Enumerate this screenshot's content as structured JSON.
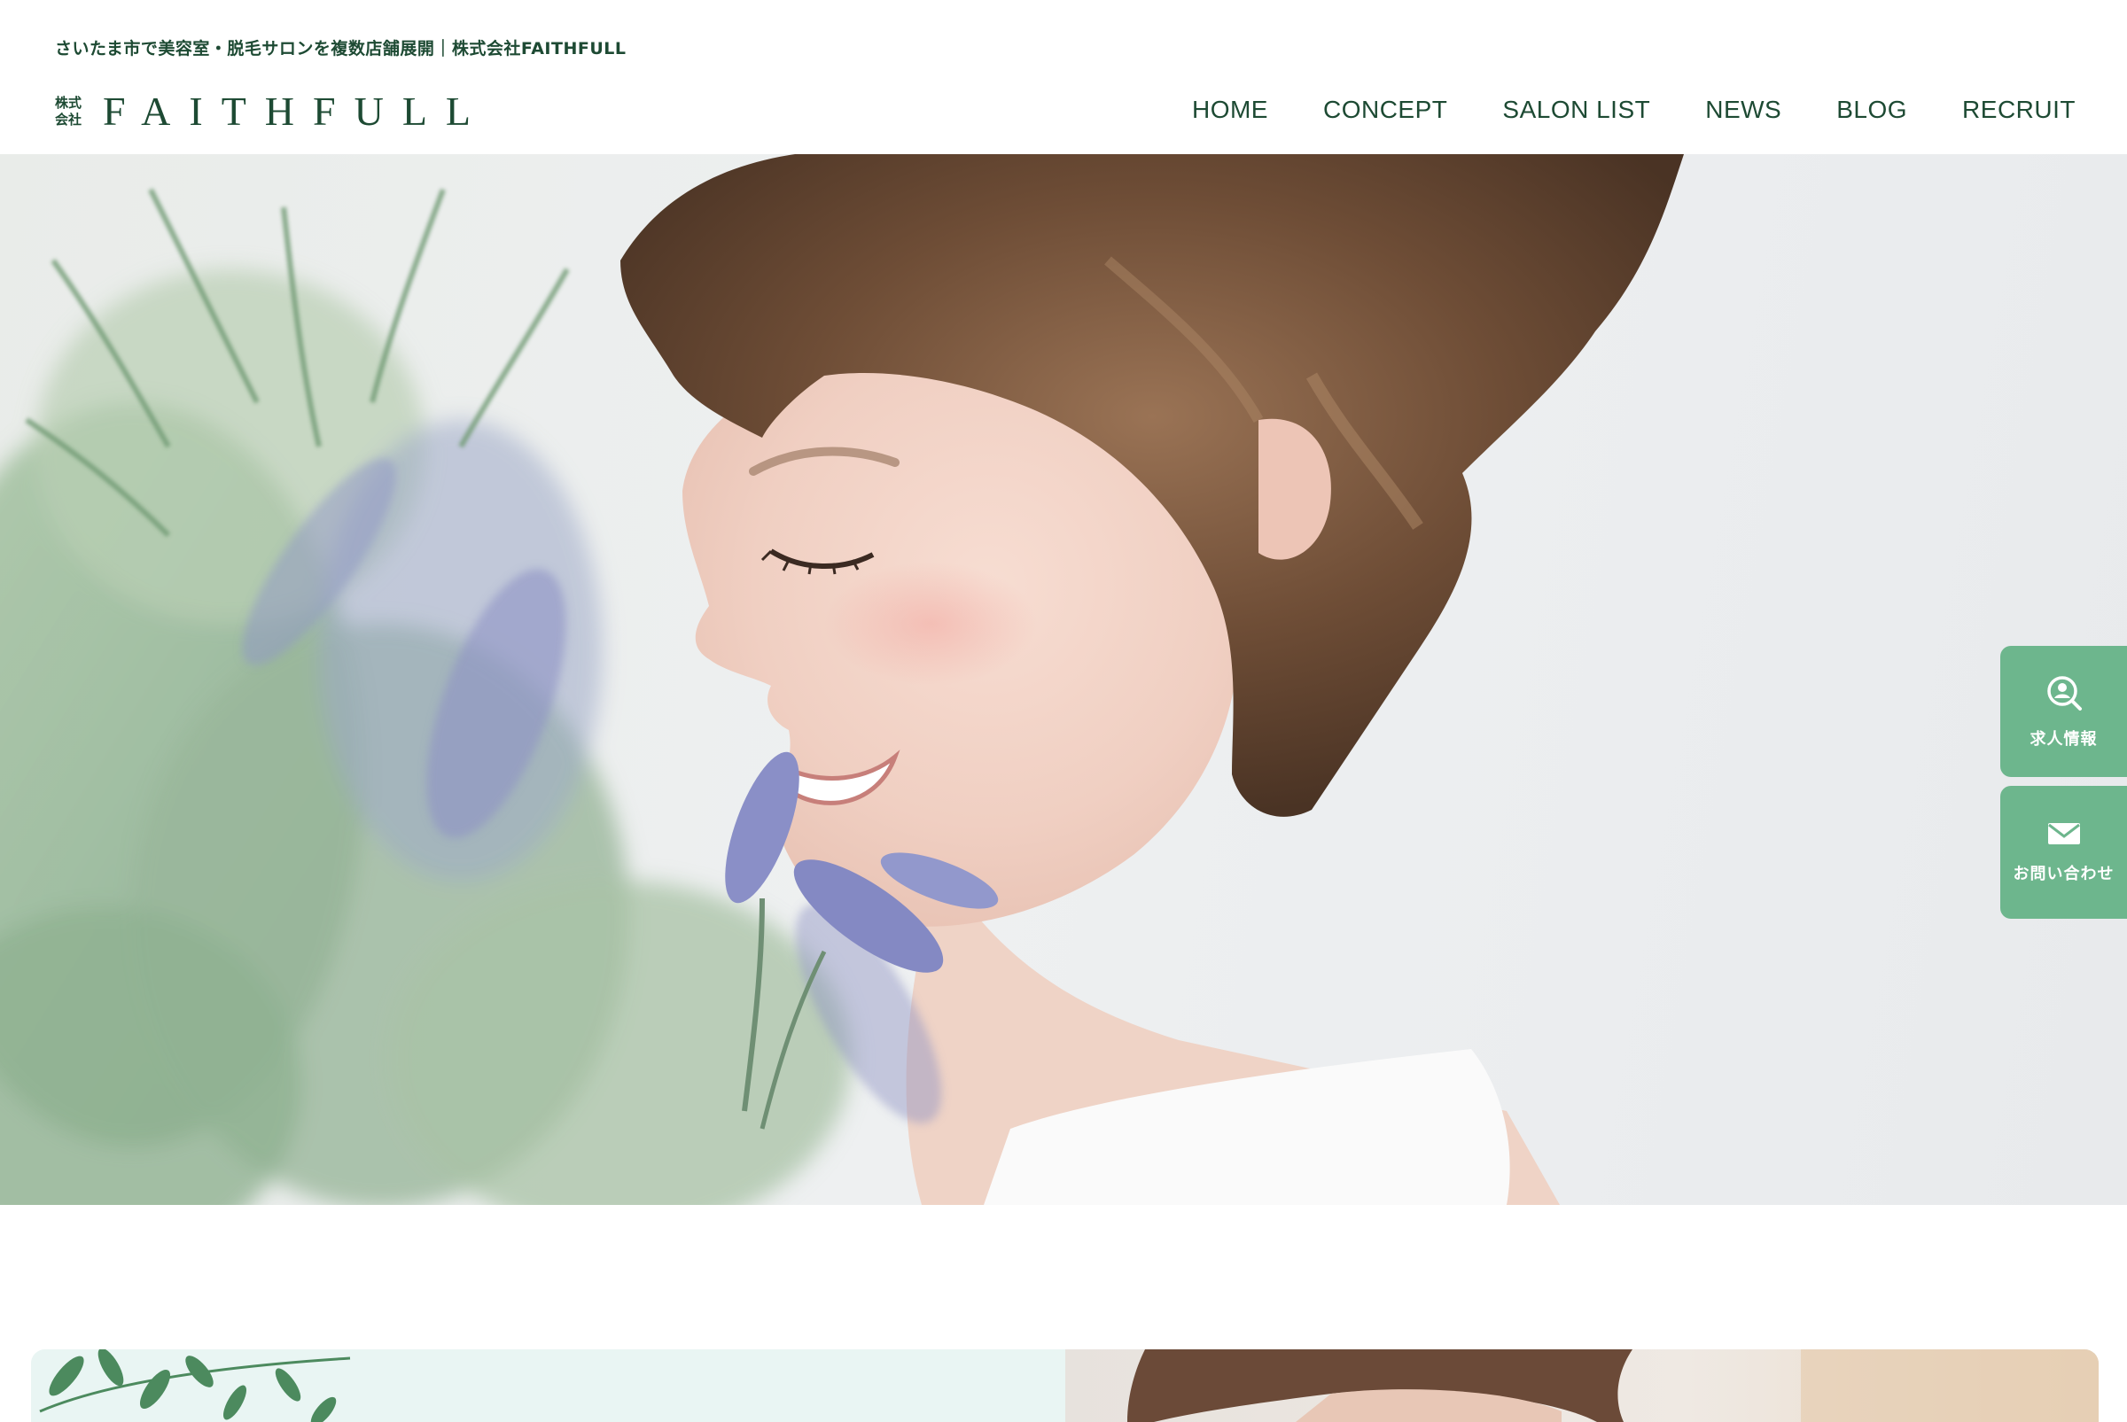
{
  "header": {
    "tagline": "さいたま市で美容室・脱毛サロンを複数店舗展開｜株式会社FAITHFULL",
    "logo": {
      "prefix_line1": "株式",
      "prefix_line2": "会社",
      "name": "FAITHFULL"
    },
    "nav": [
      {
        "label": "HOME"
      },
      {
        "label": "CONCEPT"
      },
      {
        "label": "SALON LIST"
      },
      {
        "label": "NEWS"
      },
      {
        "label": "BLOG"
      },
      {
        "label": "RECRUIT"
      }
    ]
  },
  "side_buttons": {
    "recruit": {
      "label": "求人情報",
      "icon": "search-person-icon"
    },
    "contact": {
      "label": "お問い合わせ",
      "icon": "mail-icon"
    }
  },
  "hero": {
    "image": "woman-smelling-lavender-photo"
  },
  "colors": {
    "brand_green": "#1d4a33",
    "button_green": "#6db68d",
    "background": "#ffffff"
  }
}
